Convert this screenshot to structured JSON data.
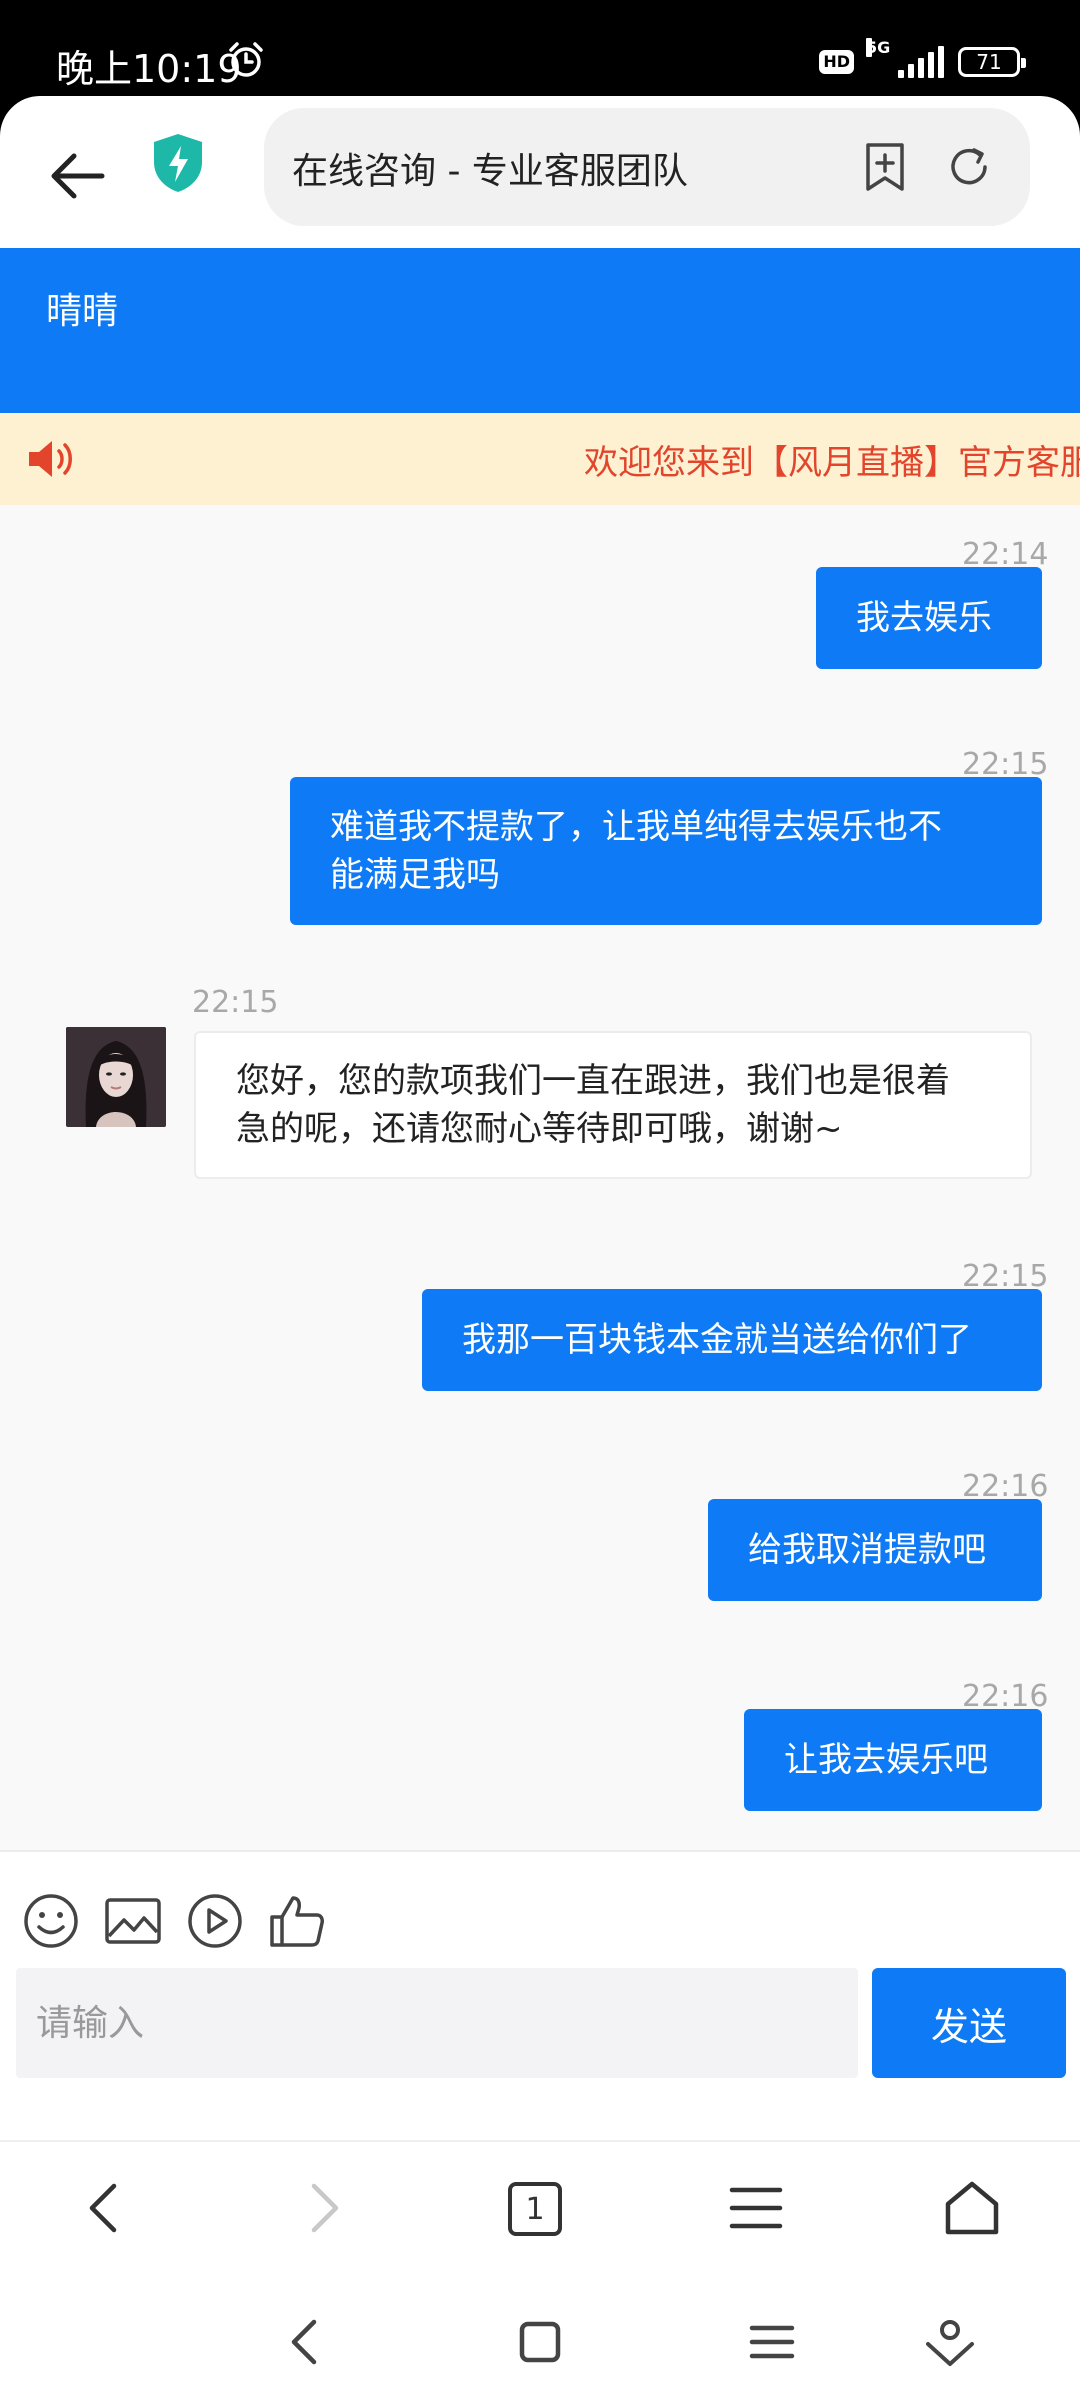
{
  "status_bar": {
    "time": "晚上10:19",
    "hd_label": "HD",
    "network_label": "5G",
    "battery_level": "71"
  },
  "browser": {
    "url_title": "在线咨询 - 专业客服团队",
    "icons": [
      "back-arrow-icon",
      "shield-lightning-icon",
      "bookmark-add-icon",
      "reload-icon"
    ],
    "accent_color": "#1db8a8"
  },
  "chat": {
    "agent_name": "晴晴",
    "header_color": "#0e7af5",
    "notice": "欢迎您来到【风月直播】官方客服",
    "messages": [
      {
        "direction": "out",
        "time": "22:14",
        "text": "我去娱乐"
      },
      {
        "direction": "out",
        "time": "22:15",
        "lines": [
          "难道我不提款了，让我单纯得去娱乐也不",
          "能满足我吗"
        ]
      },
      {
        "direction": "in",
        "time": "22:15",
        "lines": [
          "您好，您的款项我们一直在跟进，我们也是很着",
          "急的呢，还请您耐心等待即可哦，谢谢~"
        ]
      },
      {
        "direction": "out",
        "time": "22:15",
        "text": "我那一百块钱本金就当送给你们了"
      },
      {
        "direction": "out",
        "time": "22:16",
        "text": "给我取消提款吧"
      },
      {
        "direction": "out",
        "time": "22:16",
        "text": "让我去娱乐吧"
      }
    ]
  },
  "input": {
    "placeholder": "请输入",
    "send_label": "发送",
    "tools": [
      "emoji-icon",
      "image-icon",
      "video-icon",
      "thumbs-up-icon"
    ]
  },
  "browser_nav": {
    "tab_count": "1",
    "items": [
      "back-icon",
      "forward-icon",
      "tabs-icon",
      "menu-icon",
      "home-icon"
    ]
  },
  "system_nav": {
    "items": [
      "back-icon",
      "home-icon",
      "recents-icon",
      "assistant-icon"
    ]
  }
}
